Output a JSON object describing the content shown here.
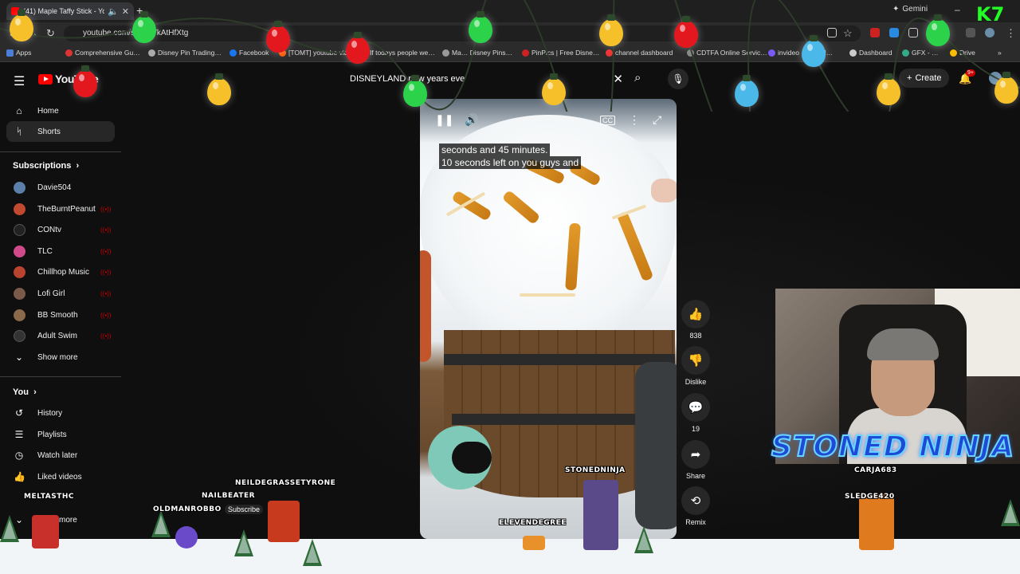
{
  "browser": {
    "tab_title": "(41) Maple Taffy Stick - You",
    "gemini_label": "Gemini",
    "url": "youtube.com/sh…dVkAtHfXtg",
    "bookmarks": [
      "Apps",
      "Comprehensive Gu…",
      "Disney Pin Trading…",
      "Facebook",
      "[TOMT] youtube vid…",
      "If todays people we…",
      "Ma… Disney Pins…",
      "PinPics | Free Disne…",
      "channel dashboard",
      "CDTFA Online Servic…",
      "invideo",
      "id…",
      "Dashboard",
      "GFX - …",
      "Drive"
    ]
  },
  "youtube": {
    "logo_text": "YouTube",
    "search_value": "DISNEYLAND new years eve",
    "create_label": "Create",
    "notif_badge": "9+"
  },
  "sidebar": {
    "main": [
      {
        "label": "Home",
        "icon": "home-icon"
      },
      {
        "label": "Shorts",
        "icon": "shorts-icon"
      }
    ],
    "subscriptions_header": "Subscriptions",
    "subscriptions": [
      {
        "label": "Davie504",
        "color": "#5a7fa8",
        "live": false
      },
      {
        "label": "TheBurntPeanut",
        "color": "#c0492f",
        "live": true
      },
      {
        "label": "CONtv",
        "color": "#222222",
        "live": true
      },
      {
        "label": "TLC",
        "color": "#d04a8a",
        "live": true
      },
      {
        "label": "Chillhop Music",
        "color": "#b8432e",
        "live": true
      },
      {
        "label": "Lofi Girl",
        "color": "#7a5a48",
        "live": true
      },
      {
        "label": "BB Smooth",
        "color": "#8a6a4a",
        "live": true
      },
      {
        "label": "Adult Swim",
        "color": "#333333",
        "live": true
      }
    ],
    "show_more": "Show more",
    "you_header": "You",
    "you_items": [
      {
        "label": "History",
        "icon": "history-icon"
      },
      {
        "label": "Playlists",
        "icon": "playlists-icon"
      },
      {
        "label": "Watch later",
        "icon": "watch-later-icon"
      },
      {
        "label": "Liked videos",
        "icon": "liked-videos-icon"
      }
    ],
    "show_more_2": "more"
  },
  "video": {
    "caption_line1": "seconds and 45 minutes.",
    "caption_line2": "10 seconds left on you guys and"
  },
  "actions": {
    "like_count": "838",
    "dislike_label": "Dislike",
    "comments_count": "19",
    "share_label": "Share",
    "remix_label": "Remix"
  },
  "overlay": {
    "streamer_name": "STONED NINJA",
    "users": {
      "neil": "NEILDEGRASSETYRONE",
      "nail": "NAILBEATER",
      "melt": "MELTASTHC",
      "oldman": "OLDMANROBBO",
      "stoned": "STONEDNINJA",
      "eleven": "ELEVENDEGREE",
      "carja": "CARJA683",
      "sledge": "SLEDGE420"
    },
    "subscribe_label": "Subscribe",
    "corner_logo": "K7"
  }
}
